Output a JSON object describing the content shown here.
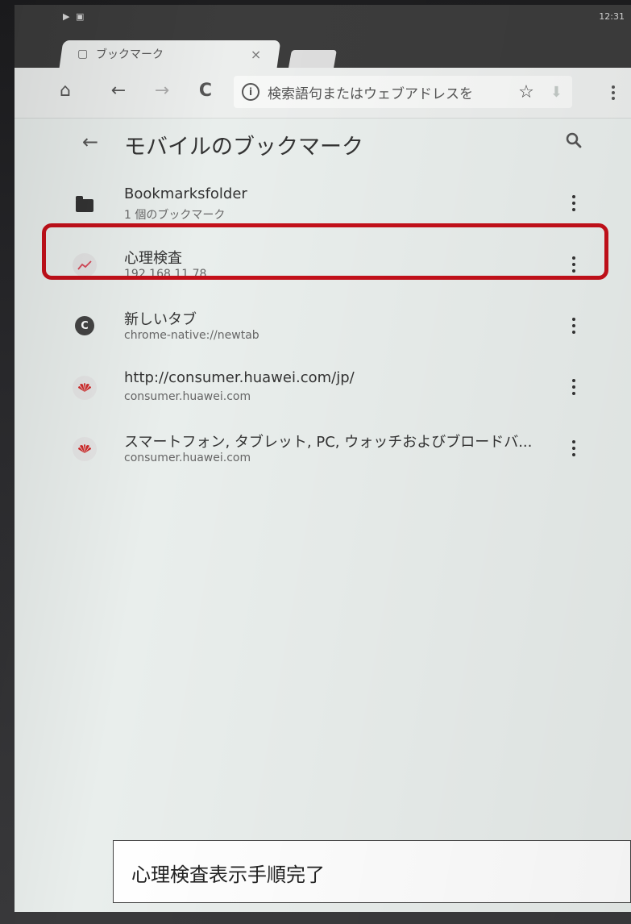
{
  "status_bar": {
    "left_icons": "▶ ▣",
    "time": "12:31"
  },
  "tab": {
    "icon": "page-icon",
    "title": "ブックマーク",
    "close": "×"
  },
  "toolbar": {
    "home": "⌂",
    "back": "←",
    "forward": "→",
    "reload": "C",
    "omnibox_placeholder": "検索語句またはウェブアドレスを",
    "info_glyph": "i",
    "star": "☆",
    "download": "⬇"
  },
  "appbar": {
    "back": "←",
    "title": "モバイルのブックマーク"
  },
  "bookmarks": [
    {
      "title": "Bookmarksfolder",
      "subtitle": "1 個のブックマーク",
      "icon": "folder-icon"
    },
    {
      "title": "心理検査",
      "subtitle": "192.168.11.78",
      "icon": "chart-icon"
    },
    {
      "title": "新しいタブ",
      "subtitle": "chrome-native://newtab",
      "icon": "chrome-icon",
      "letter": "C"
    },
    {
      "title": "http://consumer.huawei.com/jp/",
      "subtitle": "consumer.huawei.com",
      "icon": "huawei-icon"
    },
    {
      "title": "スマートフォン, タブレット, PC, ウォッチおよびブロードバ...",
      "subtitle": "consumer.huawei.com",
      "icon": "huawei-icon"
    }
  ],
  "highlight_color": "#c4101a",
  "caption": "心理検査表示手順完了"
}
